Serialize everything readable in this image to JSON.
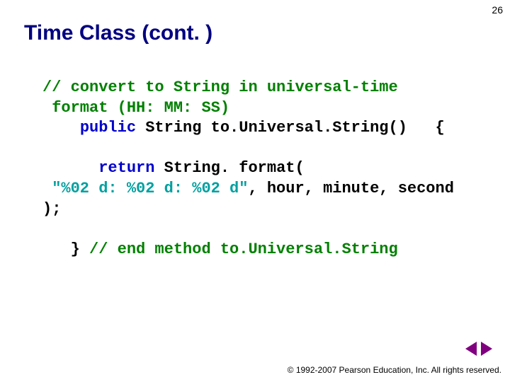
{
  "page_number": "26",
  "title": "Time Class (cont. )",
  "code": {
    "comment1": "// convert to String in universal-time\n format (HH: MM: SS)",
    "kw_public": "public",
    "rest1": " String to.Universal.String()   {",
    "kw_return": "return",
    "rest2": " String. format(",
    "str1": "\"%02 d: %02 d: %02 d\"",
    "rest3": ", hour, minute, second );",
    "rest4": "   } ",
    "comment2": "// end method to.Universal.String"
  },
  "footer": "© 1992-2007 Pearson Education, Inc.  All rights reserved."
}
